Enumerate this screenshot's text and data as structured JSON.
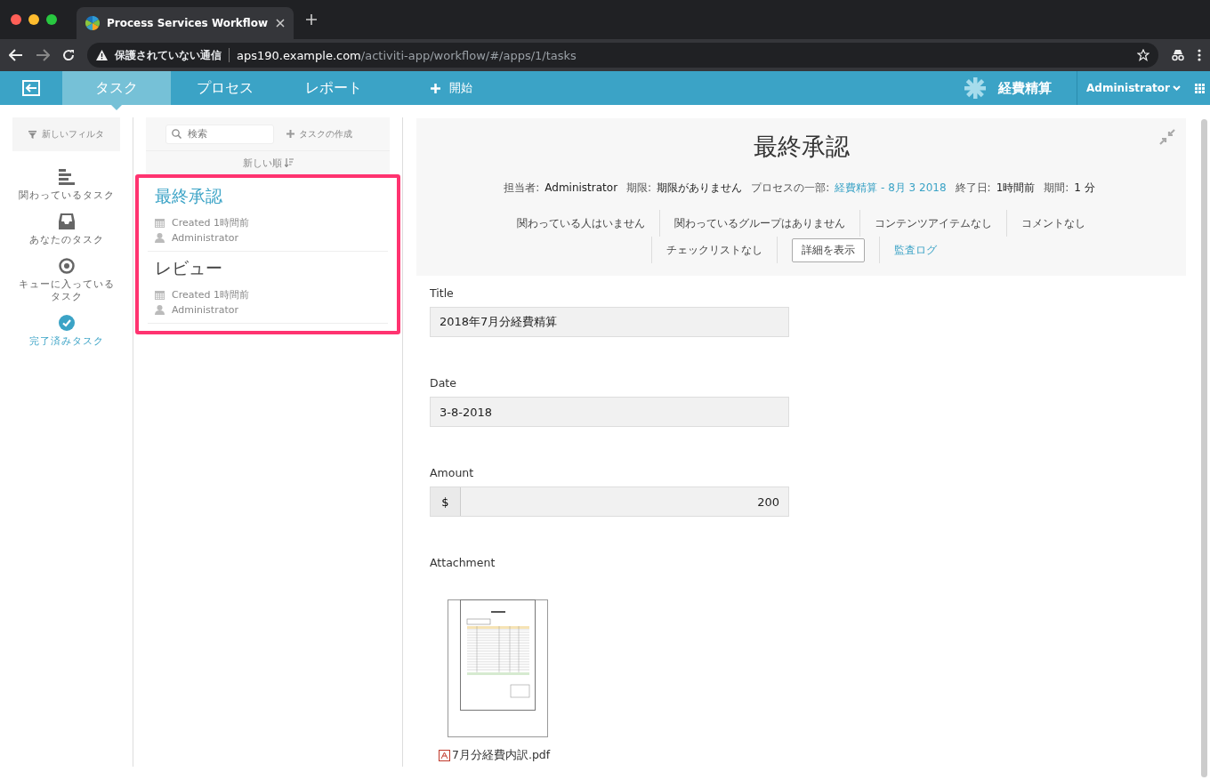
{
  "browser": {
    "tab_title": "Process Services Workflow",
    "warning": "保護されていない通信",
    "url_host": "aps190.example.com",
    "url_path": "/activiti-app/workflow/#/apps/1/tasks"
  },
  "nav": {
    "tabs": [
      {
        "label": "タスク",
        "selected": true
      },
      {
        "label": "プロセス",
        "selected": false
      },
      {
        "label": "レポート",
        "selected": false
      }
    ],
    "start": "開始",
    "app_name": "経費精算",
    "user": "Administrator"
  },
  "filters": {
    "new_filter": "新しいフィルタ",
    "items": [
      {
        "kind": "involved",
        "label": "関わっているタスク",
        "selected": false
      },
      {
        "kind": "mine",
        "label": "あなたのタスク",
        "selected": false
      },
      {
        "kind": "queued",
        "label": "キューに入っているタスク",
        "selected": false
      },
      {
        "kind": "completed",
        "label": "完了済みタスク",
        "selected": true
      }
    ]
  },
  "task_list": {
    "search_placeholder": "検索",
    "create": "タスクの作成",
    "sort": "新しい順",
    "tasks": [
      {
        "title": "最終承認",
        "selected": true,
        "created": "Created 1時間前",
        "assignee": "Administrator"
      },
      {
        "title": "レビュー",
        "selected": false,
        "created": "Created 1時間前",
        "assignee": "Administrator"
      }
    ]
  },
  "detail": {
    "title": "最終承認",
    "meta": [
      {
        "label": "担当者:",
        "value": "Administrator",
        "kind": "text"
      },
      {
        "label": "期限:",
        "value": "期限がありません",
        "kind": "text"
      },
      {
        "label": "プロセスの一部:",
        "value": "経費精算 - 8月 3 2018",
        "kind": "link"
      },
      {
        "label": "終了日:",
        "value": "1時間前",
        "kind": "text"
      },
      {
        "label": "期間:",
        "value": "1 分",
        "kind": "text"
      }
    ],
    "actions": [
      [
        {
          "kind": "text",
          "label": "関わっている人はいません"
        },
        {
          "kind": "text",
          "label": "関わっているグループはありません"
        },
        {
          "kind": "text",
          "label": "コンテンツアイテムなし"
        },
        {
          "kind": "text",
          "label": "コメントなし"
        }
      ],
      [
        {
          "kind": "text",
          "label": "チェックリストなし"
        },
        {
          "kind": "button",
          "label": "詳細を表示"
        },
        {
          "kind": "link",
          "label": "監査ログ"
        }
      ]
    ]
  },
  "form": {
    "fields": [
      {
        "kind": "text",
        "label": "Title",
        "value": "2018年7月分経費精算"
      },
      {
        "kind": "text",
        "label": "Date",
        "value": "3-8-2018"
      },
      {
        "kind": "currency",
        "label": "Amount",
        "prefix": "$",
        "value": "200"
      }
    ],
    "attachment": {
      "label": "Attachment",
      "file": "7月分経費内訳.pdf"
    }
  }
}
